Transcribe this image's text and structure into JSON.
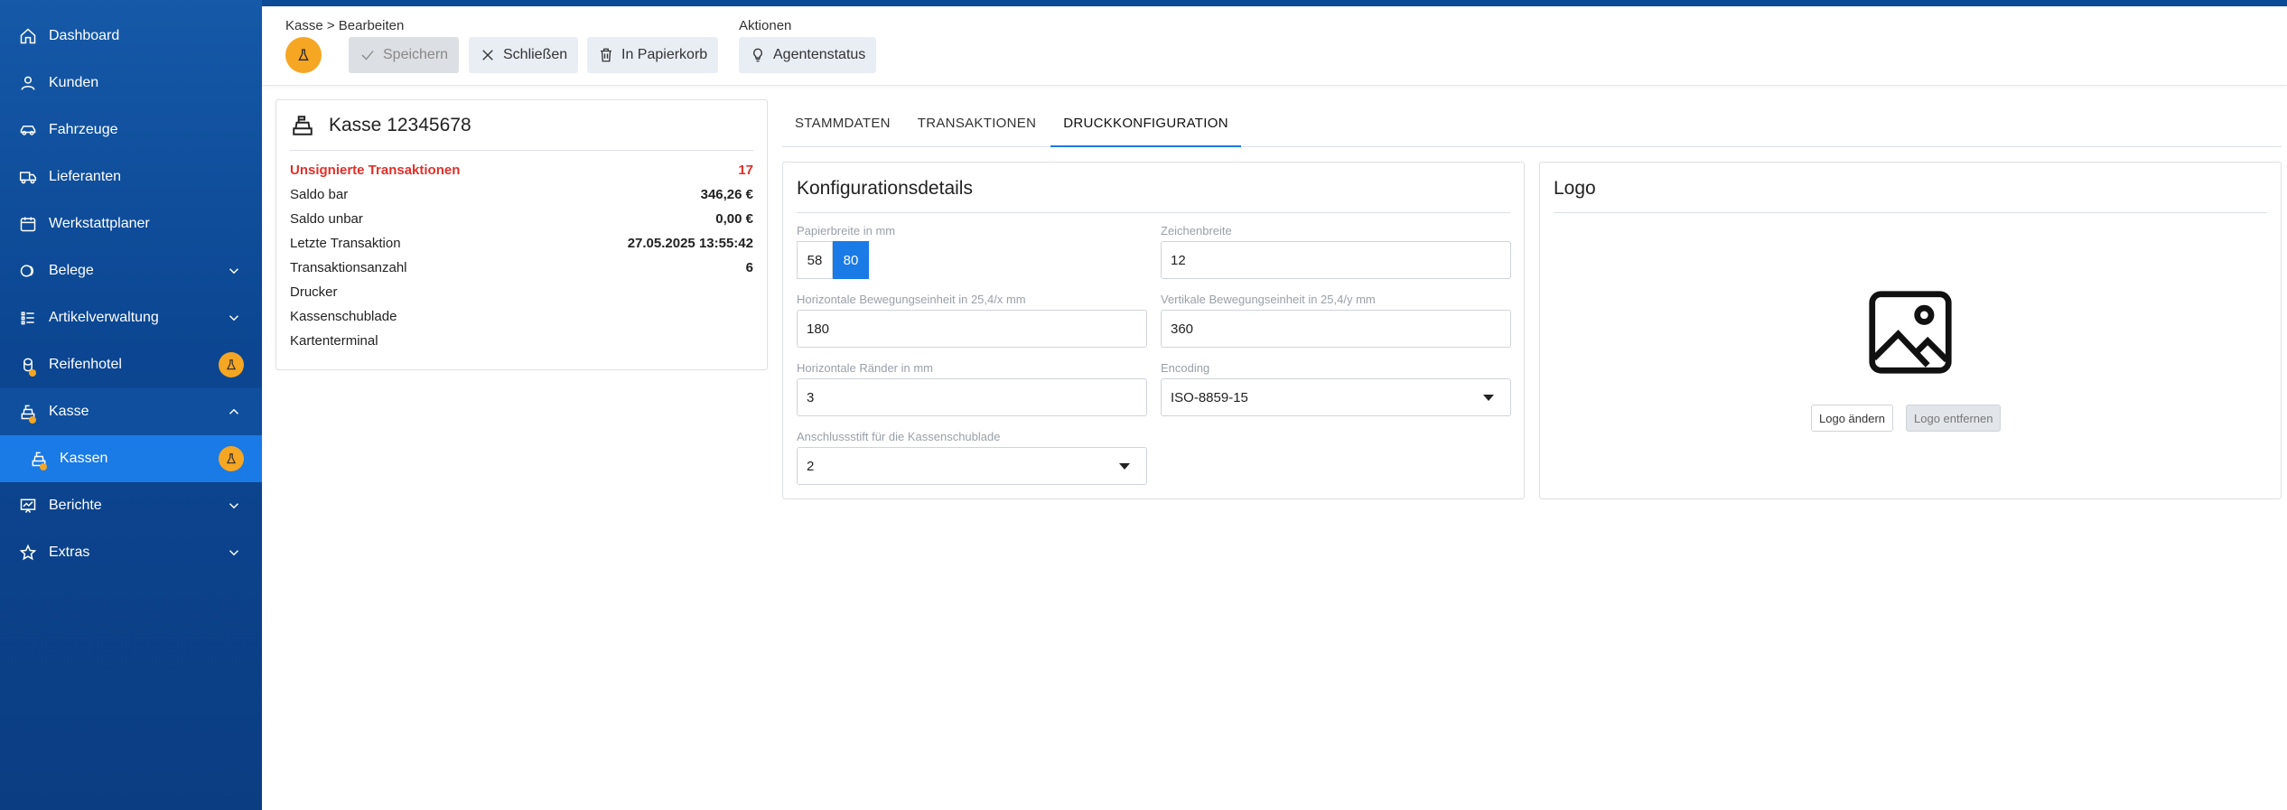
{
  "sidebar": {
    "items": [
      {
        "label": "Dashboard",
        "icon": "home-icon",
        "expandable": false
      },
      {
        "label": "Kunden",
        "icon": "user-icon",
        "expandable": false
      },
      {
        "label": "Fahrzeuge",
        "icon": "car-icon",
        "expandable": false
      },
      {
        "label": "Lieferanten",
        "icon": "truck-icon",
        "expandable": false
      },
      {
        "label": "Werkstattplaner",
        "icon": "calendar-icon",
        "expandable": false
      },
      {
        "label": "Belege",
        "icon": "coins-icon",
        "expandable": true
      },
      {
        "label": "Artikelverwaltung",
        "icon": "list-icon",
        "expandable": true
      },
      {
        "label": "Reifenhotel",
        "icon": "tire-icon",
        "expandable": false,
        "badge": "flask-icon"
      },
      {
        "label": "Kasse",
        "icon": "cash-register-icon",
        "expandable": true,
        "expanded": true
      },
      {
        "label": "Kassen",
        "icon": "cash-register-icon",
        "active": true,
        "badge": "flask-icon"
      },
      {
        "label": "Berichte",
        "icon": "chart-icon",
        "expandable": true
      },
      {
        "label": "Extras",
        "icon": "star-icon",
        "expandable": true
      }
    ]
  },
  "toolbar": {
    "breadcrumb": "Kasse > Bearbeiten",
    "actions_label": "Aktionen",
    "save": "Speichern",
    "close": "Schließen",
    "trash": "In Papierkorb",
    "agent_status": "Agentenstatus"
  },
  "register": {
    "title": "Kasse 12345678",
    "rows": [
      {
        "label": "Unsignierte Transaktionen",
        "value": "17",
        "alert": true
      },
      {
        "label": "Saldo bar",
        "value": "346,26 €"
      },
      {
        "label": "Saldo unbar",
        "value": "0,00 €"
      },
      {
        "label": "Letzte Transaktion",
        "value": "27.05.2025 13:55:42"
      },
      {
        "label": "Transaktionsanzahl",
        "value": "6"
      },
      {
        "label": "Drucker",
        "value": ""
      },
      {
        "label": "Kassenschublade",
        "value": ""
      },
      {
        "label": "Kartenterminal",
        "value": ""
      }
    ]
  },
  "tabs": [
    {
      "label": "STAMMDATEN",
      "active": false
    },
    {
      "label": "TRANSAKTIONEN",
      "active": false
    },
    {
      "label": "DRUCKKONFIGURATION",
      "active": true
    }
  ],
  "config": {
    "title": "Konfigurationsdetails",
    "paper_width": {
      "label": "Papierbreite in mm",
      "options": [
        "58",
        "80"
      ],
      "selected": "80"
    },
    "char_width": {
      "label": "Zeichenbreite",
      "value": "12"
    },
    "h_motion": {
      "label": "Horizontale Bewegungseinheit in 25,4/x mm",
      "value": "180"
    },
    "v_motion": {
      "label": "Vertikale Bewegungseinheit in 25,4/y mm",
      "value": "360"
    },
    "h_margins": {
      "label": "Horizontale Ränder in mm",
      "value": "3"
    },
    "encoding": {
      "label": "Encoding",
      "value": "ISO-8859-15"
    },
    "drawer_pin": {
      "label": "Anschlussstift für die Kassenschublade",
      "value": "2"
    }
  },
  "logo": {
    "title": "Logo",
    "change": "Logo ändern",
    "remove": "Logo entfernen"
  },
  "colors": {
    "sidebar": "#0c4793",
    "active": "#1a7ae6",
    "badge": "#f5a623",
    "alert": "#e0312b"
  }
}
